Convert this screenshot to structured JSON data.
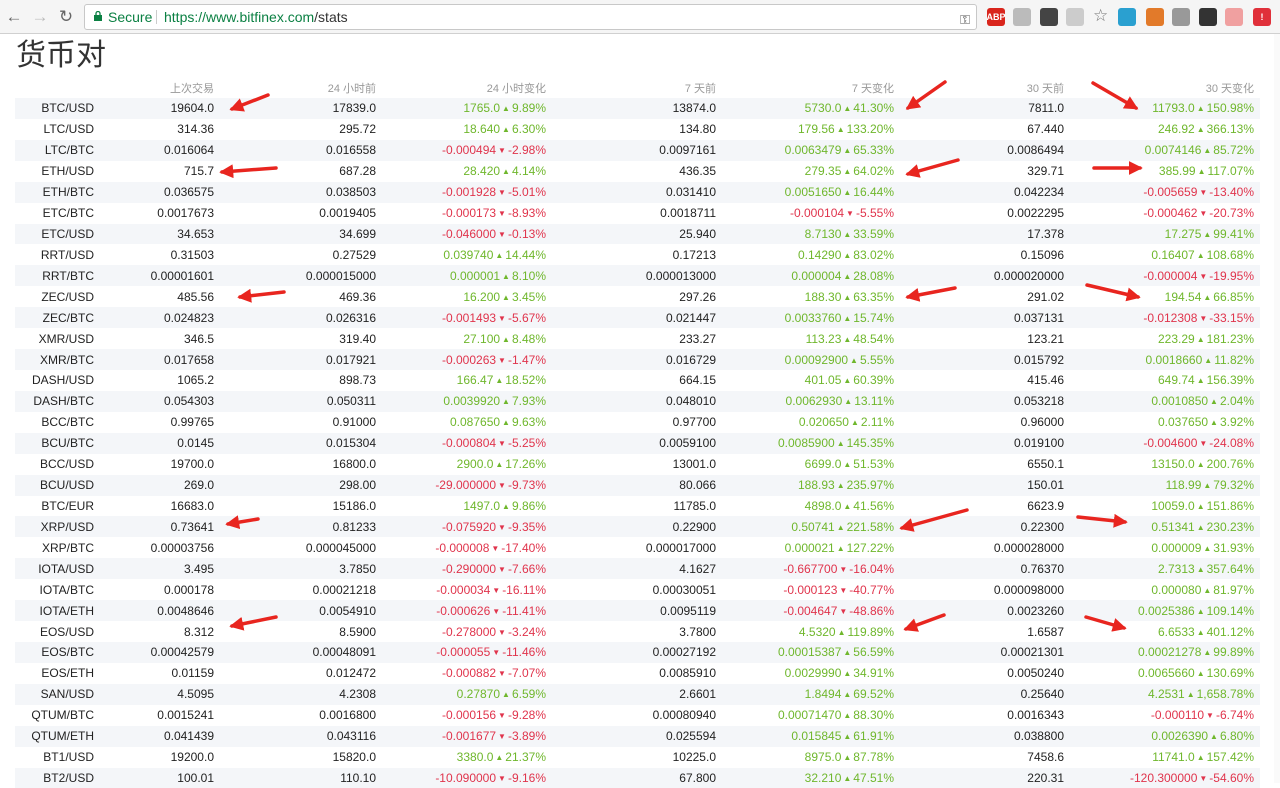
{
  "browser": {
    "secure_label": "Secure",
    "url_host": "https://www.bitfinex.com",
    "url_path": "/stats",
    "extensions": [
      {
        "name": "adblock-plus-icon",
        "label": "ABP",
        "color": "#d9251c"
      },
      {
        "name": "reader-icon",
        "label": "",
        "color": "#bbbbbb"
      },
      {
        "name": "evernote-icon",
        "label": "",
        "color": "#444444"
      },
      {
        "name": "circle-ext-icon",
        "label": "",
        "color": "#cccccc"
      },
      {
        "name": "refresh-ext-icon",
        "label": "",
        "color": "#2aa0d0"
      },
      {
        "name": "fox-ext-icon",
        "label": "",
        "color": "#e27a2a"
      },
      {
        "name": "download-ext-icon",
        "label": "",
        "color": "#999999"
      },
      {
        "name": "cow-ext-icon",
        "label": "",
        "color": "#333333"
      },
      {
        "name": "x-ext-icon",
        "label": "",
        "color": "#f0a0a0"
      },
      {
        "name": "alert-ext-icon",
        "label": "!",
        "color": "#e0303a"
      }
    ]
  },
  "page": {
    "title": "货币对"
  },
  "table": {
    "headers": [
      "",
      "上次交易",
      "24 小时前",
      "24 小时变化",
      "7 天前",
      "7 天变化",
      "30 天前",
      "30 天变化"
    ],
    "rows": [
      {
        "base": "BTC",
        "quote": "USD",
        "last": "19604.0",
        "h24": "17839.0",
        "c24": "1765.0",
        "p24": "9.89%",
        "d24": "up",
        "d7": "13874.0",
        "c7": "5730.0",
        "p7": "41.30%",
        "s7": "up",
        "d30": "7811.0",
        "c30": "11793.0",
        "p30": "150.98%",
        "s30": "up"
      },
      {
        "base": "LTC",
        "quote": "USD",
        "last": "314.36",
        "h24": "295.72",
        "c24": "18.640",
        "p24": "6.30%",
        "d24": "up",
        "d7": "134.80",
        "c7": "179.56",
        "p7": "133.20%",
        "s7": "up",
        "d30": "67.440",
        "c30": "246.92",
        "p30": "366.13%",
        "s30": "up"
      },
      {
        "base": "LTC",
        "quote": "BTC",
        "last": "0.016064",
        "h24": "0.016558",
        "c24": "-0.000494",
        "p24": "-2.98%",
        "d24": "down",
        "d7": "0.0097161",
        "c7": "0.0063479",
        "p7": "65.33%",
        "s7": "up",
        "d30": "0.0086494",
        "c30": "0.0074146",
        "p30": "85.72%",
        "s30": "up"
      },
      {
        "base": "ETH",
        "quote": "USD",
        "last": "715.7",
        "h24": "687.28",
        "c24": "28.420",
        "p24": "4.14%",
        "d24": "up",
        "d7": "436.35",
        "c7": "279.35",
        "p7": "64.02%",
        "s7": "up",
        "d30": "329.71",
        "c30": "385.99",
        "p30": "117.07%",
        "s30": "up"
      },
      {
        "base": "ETH",
        "quote": "BTC",
        "last": "0.036575",
        "h24": "0.038503",
        "c24": "-0.001928",
        "p24": "-5.01%",
        "d24": "down",
        "d7": "0.031410",
        "c7": "0.0051650",
        "p7": "16.44%",
        "s7": "up",
        "d30": "0.042234",
        "c30": "-0.005659",
        "p30": "-13.40%",
        "s30": "down"
      },
      {
        "base": "ETC",
        "quote": "BTC",
        "last": "0.0017673",
        "h24": "0.0019405",
        "c24": "-0.000173",
        "p24": "-8.93%",
        "d24": "down",
        "d7": "0.0018711",
        "c7": "-0.000104",
        "p7": "-5.55%",
        "s7": "down",
        "d30": "0.0022295",
        "c30": "-0.000462",
        "p30": "-20.73%",
        "s30": "down"
      },
      {
        "base": "ETC",
        "quote": "USD",
        "last": "34.653",
        "h24": "34.699",
        "c24": "-0.046000",
        "p24": "-0.13%",
        "d24": "down",
        "d7": "25.940",
        "c7": "8.7130",
        "p7": "33.59%",
        "s7": "up",
        "d30": "17.378",
        "c30": "17.275",
        "p30": "99.41%",
        "s30": "up"
      },
      {
        "base": "RRT",
        "quote": "USD",
        "last": "0.31503",
        "h24": "0.27529",
        "c24": "0.039740",
        "p24": "14.44%",
        "d24": "up",
        "d7": "0.17213",
        "c7": "0.14290",
        "p7": "83.02%",
        "s7": "up",
        "d30": "0.15096",
        "c30": "0.16407",
        "p30": "108.68%",
        "s30": "up"
      },
      {
        "base": "RRT",
        "quote": "BTC",
        "last": "0.00001601",
        "h24": "0.000015000",
        "c24": "0.000001",
        "p24": "8.10%",
        "d24": "up",
        "d7": "0.000013000",
        "c7": "0.000004",
        "p7": "28.08%",
        "s7": "up",
        "d30": "0.000020000",
        "c30": "-0.000004",
        "p30": "-19.95%",
        "s30": "down"
      },
      {
        "base": "ZEC",
        "quote": "USD",
        "last": "485.56",
        "h24": "469.36",
        "c24": "16.200",
        "p24": "3.45%",
        "d24": "up",
        "d7": "297.26",
        "c7": "188.30",
        "p7": "63.35%",
        "s7": "up",
        "d30": "291.02",
        "c30": "194.54",
        "p30": "66.85%",
        "s30": "up"
      },
      {
        "base": "ZEC",
        "quote": "BTC",
        "last": "0.024823",
        "h24": "0.026316",
        "c24": "-0.001493",
        "p24": "-5.67%",
        "d24": "down",
        "d7": "0.021447",
        "c7": "0.0033760",
        "p7": "15.74%",
        "s7": "up",
        "d30": "0.037131",
        "c30": "-0.012308",
        "p30": "-33.15%",
        "s30": "down"
      },
      {
        "base": "XMR",
        "quote": "USD",
        "last": "346.5",
        "h24": "319.40",
        "c24": "27.100",
        "p24": "8.48%",
        "d24": "up",
        "d7": "233.27",
        "c7": "113.23",
        "p7": "48.54%",
        "s7": "up",
        "d30": "123.21",
        "c30": "223.29",
        "p30": "181.23%",
        "s30": "up"
      },
      {
        "base": "XMR",
        "quote": "BTC",
        "last": "0.017658",
        "h24": "0.017921",
        "c24": "-0.000263",
        "p24": "-1.47%",
        "d24": "down",
        "d7": "0.016729",
        "c7": "0.00092900",
        "p7": "5.55%",
        "s7": "up",
        "d30": "0.015792",
        "c30": "0.0018660",
        "p30": "11.82%",
        "s30": "up"
      },
      {
        "base": "DASH",
        "quote": "USD",
        "last": "1065.2",
        "h24": "898.73",
        "c24": "166.47",
        "p24": "18.52%",
        "d24": "up",
        "d7": "664.15",
        "c7": "401.05",
        "p7": "60.39%",
        "s7": "up",
        "d30": "415.46",
        "c30": "649.74",
        "p30": "156.39%",
        "s30": "up"
      },
      {
        "base": "DASH",
        "quote": "BTC",
        "last": "0.054303",
        "h24": "0.050311",
        "c24": "0.0039920",
        "p24": "7.93%",
        "d24": "up",
        "d7": "0.048010",
        "c7": "0.0062930",
        "p7": "13.11%",
        "s7": "up",
        "d30": "0.053218",
        "c30": "0.0010850",
        "p30": "2.04%",
        "s30": "up"
      },
      {
        "base": "BCC",
        "quote": "BTC",
        "last": "0.99765",
        "h24": "0.91000",
        "c24": "0.087650",
        "p24": "9.63%",
        "d24": "up",
        "d7": "0.97700",
        "c7": "0.020650",
        "p7": "2.11%",
        "s7": "up",
        "d30": "0.96000",
        "c30": "0.037650",
        "p30": "3.92%",
        "s30": "up"
      },
      {
        "base": "BCU",
        "quote": "BTC",
        "last": "0.0145",
        "h24": "0.015304",
        "c24": "-0.000804",
        "p24": "-5.25%",
        "d24": "down",
        "d7": "0.0059100",
        "c7": "0.0085900",
        "p7": "145.35%",
        "s7": "up",
        "d30": "0.019100",
        "c30": "-0.004600",
        "p30": "-24.08%",
        "s30": "down"
      },
      {
        "base": "BCC",
        "quote": "USD",
        "last": "19700.0",
        "h24": "16800.0",
        "c24": "2900.0",
        "p24": "17.26%",
        "d24": "up",
        "d7": "13001.0",
        "c7": "6699.0",
        "p7": "51.53%",
        "s7": "up",
        "d30": "6550.1",
        "c30": "13150.0",
        "p30": "200.76%",
        "s30": "up"
      },
      {
        "base": "BCU",
        "quote": "USD",
        "last": "269.0",
        "h24": "298.00",
        "c24": "-29.000000",
        "p24": "-9.73%",
        "d24": "down",
        "d7": "80.066",
        "c7": "188.93",
        "p7": "235.97%",
        "s7": "up",
        "d30": "150.01",
        "c30": "118.99",
        "p30": "79.32%",
        "s30": "up"
      },
      {
        "base": "BTC",
        "quote": "EUR",
        "last": "16683.0",
        "h24": "15186.0",
        "c24": "1497.0",
        "p24": "9.86%",
        "d24": "up",
        "d7": "11785.0",
        "c7": "4898.0",
        "p7": "41.56%",
        "s7": "up",
        "d30": "6623.9",
        "c30": "10059.0",
        "p30": "151.86%",
        "s30": "up"
      },
      {
        "base": "XRP",
        "quote": "USD",
        "last": "0.73641",
        "h24": "0.81233",
        "c24": "-0.075920",
        "p24": "-9.35%",
        "d24": "down",
        "d7": "0.22900",
        "c7": "0.50741",
        "p7": "221.58%",
        "s7": "up",
        "d30": "0.22300",
        "c30": "0.51341",
        "p30": "230.23%",
        "s30": "up"
      },
      {
        "base": "XRP",
        "quote": "BTC",
        "last": "0.00003756",
        "h24": "0.000045000",
        "c24": "-0.000008",
        "p24": "-17.40%",
        "d24": "down",
        "d7": "0.000017000",
        "c7": "0.000021",
        "p7": "127.22%",
        "s7": "up",
        "d30": "0.000028000",
        "c30": "0.000009",
        "p30": "31.93%",
        "s30": "up"
      },
      {
        "base": "IOTA",
        "quote": "USD",
        "last": "3.495",
        "h24": "3.7850",
        "c24": "-0.290000",
        "p24": "-7.66%",
        "d24": "down",
        "d7": "4.1627",
        "c7": "-0.667700",
        "p7": "-16.04%",
        "s7": "down",
        "d30": "0.76370",
        "c30": "2.7313",
        "p30": "357.64%",
        "s30": "up"
      },
      {
        "base": "IOTA",
        "quote": "BTC",
        "last": "0.000178",
        "h24": "0.00021218",
        "c24": "-0.000034",
        "p24": "-16.11%",
        "d24": "down",
        "d7": "0.00030051",
        "c7": "-0.000123",
        "p7": "-40.77%",
        "s7": "down",
        "d30": "0.000098000",
        "c30": "0.000080",
        "p30": "81.97%",
        "s30": "up"
      },
      {
        "base": "IOTA",
        "quote": "ETH",
        "last": "0.0048646",
        "h24": "0.0054910",
        "c24": "-0.000626",
        "p24": "-11.41%",
        "d24": "down",
        "d7": "0.0095119",
        "c7": "-0.004647",
        "p7": "-48.86%",
        "s7": "down",
        "d30": "0.0023260",
        "c30": "0.0025386",
        "p30": "109.14%",
        "s30": "up"
      },
      {
        "base": "EOS",
        "quote": "USD",
        "last": "8.312",
        "h24": "8.5900",
        "c24": "-0.278000",
        "p24": "-3.24%",
        "d24": "down",
        "d7": "3.7800",
        "c7": "4.5320",
        "p7": "119.89%",
        "s7": "up",
        "d30": "1.6587",
        "c30": "6.6533",
        "p30": "401.12%",
        "s30": "up"
      },
      {
        "base": "EOS",
        "quote": "BTC",
        "last": "0.00042579",
        "h24": "0.00048091",
        "c24": "-0.000055",
        "p24": "-11.46%",
        "d24": "down",
        "d7": "0.00027192",
        "c7": "0.00015387",
        "p7": "56.59%",
        "s7": "up",
        "d30": "0.00021301",
        "c30": "0.00021278",
        "p30": "99.89%",
        "s30": "up"
      },
      {
        "base": "EOS",
        "quote": "ETH",
        "last": "0.01159",
        "h24": "0.012472",
        "c24": "-0.000882",
        "p24": "-7.07%",
        "d24": "down",
        "d7": "0.0085910",
        "c7": "0.0029990",
        "p7": "34.91%",
        "s7": "up",
        "d30": "0.0050240",
        "c30": "0.0065660",
        "p30": "130.69%",
        "s30": "up"
      },
      {
        "base": "SAN",
        "quote": "USD",
        "last": "4.5095",
        "h24": "4.2308",
        "c24": "0.27870",
        "p24": "6.59%",
        "d24": "up",
        "d7": "2.6601",
        "c7": "1.8494",
        "p7": "69.52%",
        "s7": "up",
        "d30": "0.25640",
        "c30": "4.2531",
        "p30": "1,658.78%",
        "s30": "up"
      },
      {
        "base": "QTUM",
        "quote": "BTC",
        "last": "0.0015241",
        "h24": "0.0016800",
        "c24": "-0.000156",
        "p24": "-9.28%",
        "d24": "down",
        "d7": "0.00080940",
        "c7": "0.00071470",
        "p7": "88.30%",
        "s7": "up",
        "d30": "0.0016343",
        "c30": "-0.000110",
        "p30": "-6.74%",
        "s30": "down"
      },
      {
        "base": "QTUM",
        "quote": "ETH",
        "last": "0.041439",
        "h24": "0.043116",
        "c24": "-0.001677",
        "p24": "-3.89%",
        "d24": "down",
        "d7": "0.025594",
        "c7": "0.015845",
        "p7": "61.91%",
        "s7": "up",
        "d30": "0.038800",
        "c30": "0.0026390",
        "p30": "6.80%",
        "s30": "up"
      },
      {
        "base": "BT1",
        "quote": "USD",
        "last": "19200.0",
        "h24": "15820.0",
        "c24": "3380.0",
        "p24": "21.37%",
        "d24": "up",
        "d7": "10225.0",
        "c7": "8975.0",
        "p7": "87.78%",
        "s7": "up",
        "d30": "7458.6",
        "c30": "11741.0",
        "p30": "157.42%",
        "s30": "up"
      },
      {
        "base": "BT2",
        "quote": "USD",
        "last": "100.01",
        "h24": "110.10",
        "c24": "-10.090000",
        "p24": "-9.16%",
        "d24": "down",
        "d7": "67.800",
        "c7": "32.210",
        "p7": "47.51%",
        "s7": "up",
        "d30": "220.31",
        "c30": "-120.300000",
        "p30": "-54.60%",
        "s30": "down"
      }
    ]
  },
  "colors": {
    "up": "#6fb72c",
    "down": "#e0344c",
    "annotation_arrow": "#e8251f"
  }
}
